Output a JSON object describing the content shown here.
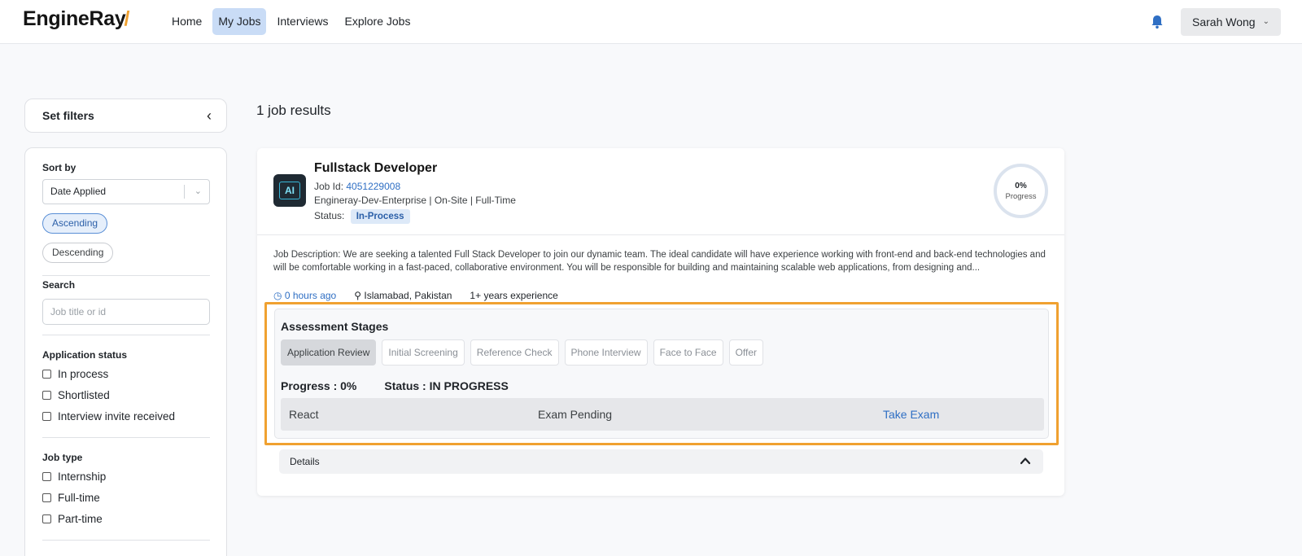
{
  "header": {
    "logo": "EngineRay",
    "nav": [
      {
        "label": "Home",
        "active": false
      },
      {
        "label": "My Jobs",
        "active": true
      },
      {
        "label": "Interviews",
        "active": false
      },
      {
        "label": "Explore Jobs",
        "active": false
      }
    ],
    "notification_icon": "bell-icon",
    "user": "Sarah Wong"
  },
  "sidebar": {
    "title": "Set filters",
    "sort": {
      "label": "Sort by",
      "selected": "Date Applied",
      "ascending": "Ascending",
      "descending": "Descending",
      "active_order": "Ascending"
    },
    "search": {
      "label": "Search",
      "placeholder": "Job title or id"
    },
    "application_status": {
      "label": "Application status",
      "options": [
        "In process",
        "Shortlisted",
        "Interview invite received"
      ]
    },
    "job_type": {
      "label": "Job type",
      "options": [
        "Internship",
        "Full-time",
        "Part-time"
      ]
    }
  },
  "results": {
    "count_text": "1 job results"
  },
  "job": {
    "title": "Fullstack Developer",
    "id_label": "Job Id:",
    "id": "4051229008",
    "company_line": "Engineray-Dev-Enterprise | On-Site | Full-Time",
    "status_label": "Status:",
    "status": "In-Process",
    "progress_ring": {
      "value": "0%",
      "label": "Progress"
    },
    "description": "Job Description: We are seeking a talented Full Stack Developer to join our dynamic team. The ideal candidate will have experience working with front-end and back-end technologies and will be comfortable working in a fast-paced, collaborative environment. You will be responsible for building and maintaining scalable web applications, from designing and...",
    "posted": "0 hours ago",
    "location": "Islamabad, Pakistan",
    "experience": "1+ years experience",
    "assessment": {
      "title": "Assessment Stages",
      "stages": [
        "Application Review",
        "Initial Screening",
        "Reference Check",
        "Phone Interview",
        "Face to Face",
        "Offer"
      ],
      "current_stage": "Application Review",
      "progress": "Progress : 0%",
      "status": "Status : IN PROGRESS",
      "exam": {
        "name": "React",
        "state": "Exam Pending",
        "action": "Take Exam"
      }
    },
    "details_label": "Details"
  },
  "colors": {
    "accent": "#2f6fc4",
    "highlight": "#f0a130",
    "nav_active": "#c9dcf6"
  }
}
